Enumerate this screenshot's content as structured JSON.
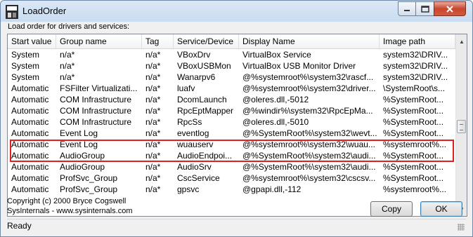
{
  "window": {
    "title": "LoadOrder"
  },
  "caption": "Load order for drivers and services:",
  "columns": [
    "Start value",
    "Group name",
    "Tag",
    "Service/Device",
    "Display Name",
    "Image path"
  ],
  "rows": [
    [
      "System",
      "n/a*",
      "n/a*",
      "VBoxDrv",
      "VirtualBox Service",
      "system32\\DRIV..."
    ],
    [
      "System",
      "n/a*",
      "n/a*",
      "VBoxUSBMon",
      "VirtualBox USB Monitor Driver",
      "system32\\DRIV..."
    ],
    [
      "System",
      "n/a*",
      "n/a*",
      "Wanarpv6",
      "@%systemroot%\\system32\\rascf...",
      "system32\\DRIV..."
    ],
    [
      "Automatic",
      "FSFilter Virtualizati...",
      "n/a*",
      "luafv",
      "@%systemroot%\\system32\\driver...",
      "\\SystemRoot\\s..."
    ],
    [
      "Automatic",
      "COM Infrastructure",
      "n/a*",
      "DcomLaunch",
      "@oleres.dll,-5012",
      "%SystemRoot..."
    ],
    [
      "Automatic",
      "COM Infrastructure",
      "n/a*",
      "RpcEptMapper",
      "@%windir%\\system32\\RpcEpMa...",
      "%SystemRoot..."
    ],
    [
      "Automatic",
      "COM Infrastructure",
      "n/a*",
      "RpcSs",
      "@oleres.dll,-5010",
      "%SystemRoot..."
    ],
    [
      "Automatic",
      "Event Log",
      "n/a*",
      "eventlog",
      "@%SystemRoot%\\system32\\wevt...",
      "%SystemRoot..."
    ],
    [
      "Automatic",
      "Event Log",
      "n/a*",
      "wuauserv",
      "@%systemroot%\\system32\\wuau...",
      "%systemroot%..."
    ],
    [
      "Automatic",
      "AudioGroup",
      "n/a*",
      "AudioEndpoi...",
      "@%SystemRoot%\\system32\\audi...",
      "%SystemRoot..."
    ],
    [
      "Automatic",
      "AudioGroup",
      "n/a*",
      "AudioSrv",
      "@%SystemRoot%\\system32\\audi...",
      "%SystemRoot..."
    ],
    [
      "Automatic",
      "ProfSvc_Group",
      "n/a*",
      "CscService",
      "@%systemroot%\\system32\\cscsv...",
      "%SystemRoot..."
    ],
    [
      "Automatic",
      "ProfSvc_Group",
      "n/a*",
      "gpsvc",
      "@gpapi.dll,-112",
      "%systemroot%..."
    ]
  ],
  "copyright": {
    "line1": "Copyright (c) 2000 Bryce Cogswell",
    "line2": "SysInternals - www.sysinternals.com"
  },
  "buttons": {
    "copy": "Copy",
    "ok": "OK"
  },
  "status": "Ready",
  "highlight_color": "#e02020"
}
